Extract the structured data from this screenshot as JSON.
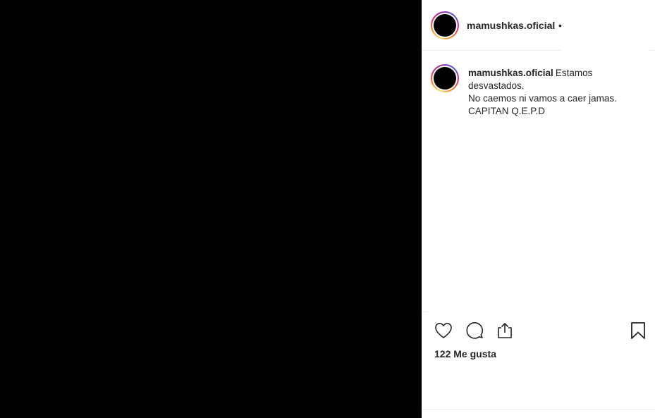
{
  "post": {
    "username": "mamushkas.oficial",
    "follow_separator": "•",
    "caption_line_1": "Estamos desvastados.",
    "caption_line_2": "No caemos ni vamos a caer jamas.",
    "caption_line_3": "CAPITAN Q.E.P.D",
    "likes_text": "122 Me gusta"
  },
  "icons": {
    "like": "heart-icon",
    "comment": "comment-icon",
    "share": "share-icon",
    "save": "bookmark-icon"
  },
  "colors": {
    "media_background": "#000000",
    "text": "#262626",
    "divider": "#efefef"
  }
}
